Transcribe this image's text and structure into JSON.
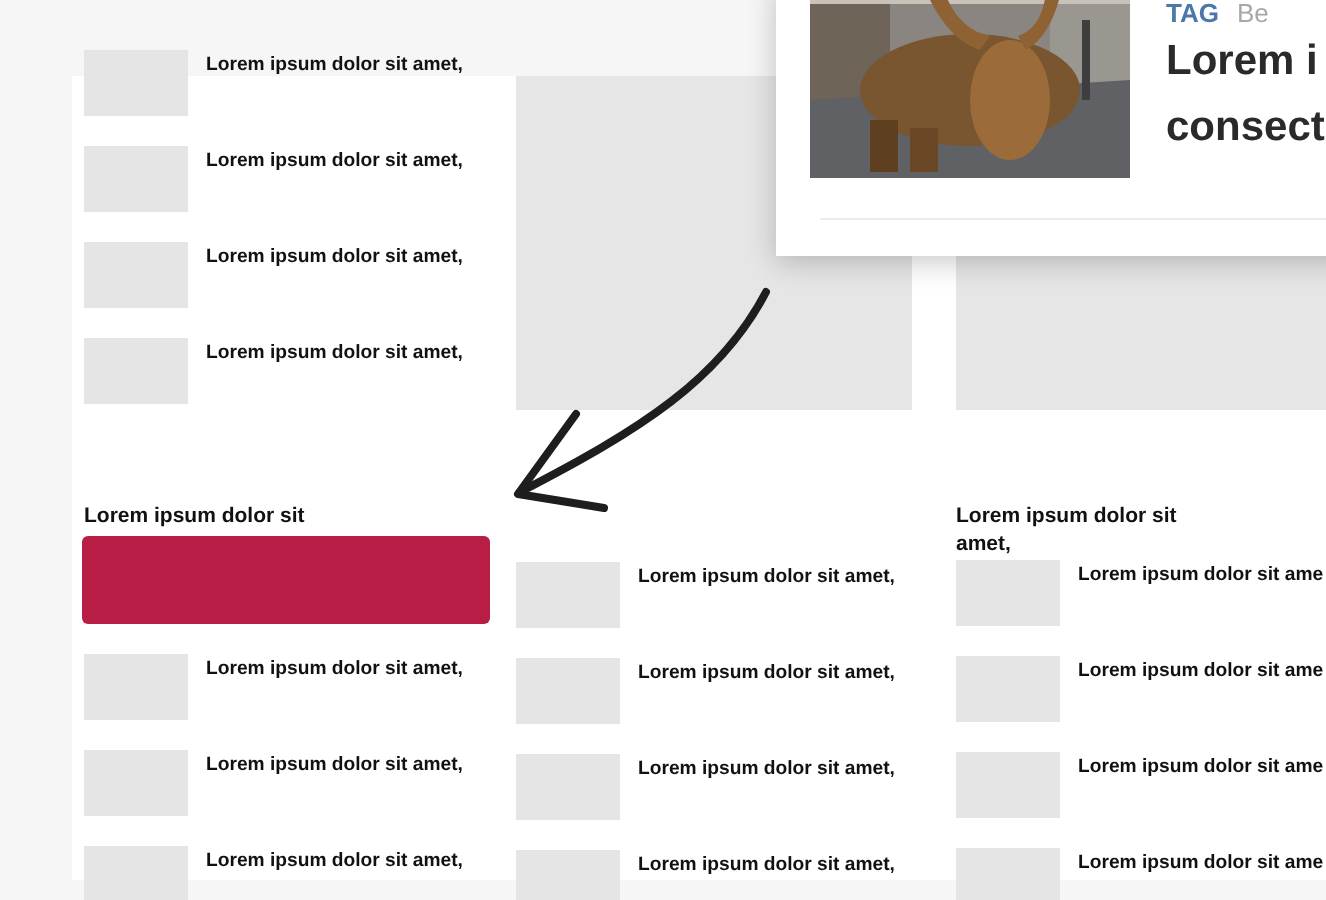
{
  "top_list": [
    {
      "text": "Lorem ipsum dolor sit amet,"
    },
    {
      "text": "Lorem ipsum dolor sit amet,"
    },
    {
      "text": "Lorem ipsum dolor sit amet,"
    },
    {
      "text": "Lorem ipsum dolor sit amet,"
    }
  ],
  "columns": [
    {
      "heading": "Lorem ipsum dolor sit",
      "banner": true,
      "items": [
        {
          "text": "Lorem ipsum dolor sit amet,"
        },
        {
          "text": "Lorem ipsum dolor sit amet,"
        },
        {
          "text": "Lorem ipsum dolor sit amet,"
        }
      ]
    },
    {
      "items": [
        {
          "text": "Lorem ipsum dolor sit amet,"
        },
        {
          "text": "Lorem ipsum dolor sit amet,"
        },
        {
          "text": "Lorem ipsum dolor sit amet,"
        },
        {
          "text": "Lorem ipsum dolor sit amet,"
        }
      ]
    },
    {
      "heading": "Lorem ipsum dolor sit amet,",
      "items": [
        {
          "text": "Lorem ipsum dolor sit ame"
        },
        {
          "text": "Lorem ipsum dolor sit ame"
        },
        {
          "text": "Lorem ipsum dolor sit ame"
        },
        {
          "text": "Lorem ipsum dolor sit ame"
        }
      ]
    }
  ],
  "popup": {
    "tag": "TAG",
    "category": "Be",
    "title_lines": [
      "Lorem i",
      "consect"
    ]
  }
}
